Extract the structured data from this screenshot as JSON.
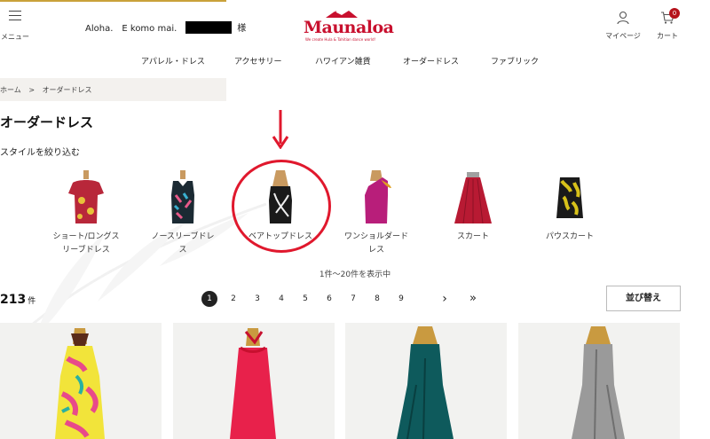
{
  "header": {
    "menu_label": "メニュー",
    "greeting": "Aloha.　E komo mai.",
    "honorific": "様",
    "logo_text": "Maunaloa",
    "logo_tagline": "We create Hula & Tahitian dance world!",
    "mypage_label": "マイページ",
    "cart_label": "カート",
    "cart_count": "0"
  },
  "nav": {
    "items": [
      "アパレル・ドレス",
      "アクセサリー",
      "ハワイアン雑貨",
      "オーダードレス",
      "ファブリック"
    ]
  },
  "breadcrumb": {
    "home": "ホーム",
    "separator": ">",
    "current": "オーダードレス"
  },
  "page_title": "オーダードレス",
  "filter_heading": "スタイルを絞り込む",
  "styles": [
    {
      "line1": "ショート/ロングス",
      "line2": "リーブドレス",
      "icon": "dress-sleeves-icon",
      "color": "#b8273a"
    },
    {
      "line1": "ノースリーブドレ",
      "line2": "ス",
      "icon": "dress-sleeveless-icon",
      "color": "#1b2a33"
    },
    {
      "line1": "ベアトップドレス",
      "line2": "",
      "icon": "dress-bare-top-icon",
      "color": "#1a1a1a"
    },
    {
      "line1": "ワンショルダード",
      "line2": "レス",
      "icon": "dress-one-shoulder-icon",
      "color": "#b81e7a"
    },
    {
      "line1": "スカート",
      "line2": "",
      "icon": "skirt-icon",
      "color": "#b81a33"
    },
    {
      "line1": "パウスカート",
      "line2": "",
      "icon": "pau-skirt-icon",
      "color": "#d8c21a"
    }
  ],
  "results_range": "1件～20件を表示中",
  "total_count": "213",
  "total_unit": "件",
  "pagination": {
    "pages": [
      "1",
      "2",
      "3",
      "4",
      "5",
      "6",
      "7",
      "8",
      "9"
    ],
    "current": "1",
    "next_symbol": "›",
    "last_symbol": "»"
  },
  "sort_label": "並び替え",
  "products": [
    {
      "color": "#f2e43a",
      "accent": "#e84a8a",
      "icon": "halter-dress-floral"
    },
    {
      "color": "#e8214b",
      "accent": "#c7102f",
      "icon": "halter-dress-red"
    },
    {
      "color": "#0e5a5c",
      "accent": "#093f40",
      "icon": "bare-top-dress-teal"
    },
    {
      "color": "#9a9a9a",
      "accent": "#6f6f6f",
      "icon": "bare-top-dress-gray"
    }
  ],
  "colors": {
    "accent_red": "#e0182d",
    "brand_red": "#c8102e",
    "gold": "#c9a13a"
  }
}
